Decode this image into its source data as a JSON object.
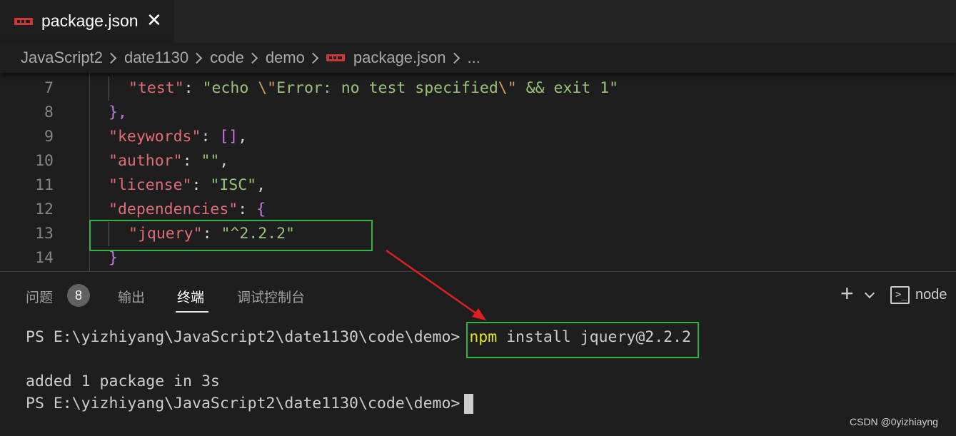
{
  "tab": {
    "icon": "npm-icon",
    "label": "package.json",
    "close": "✕"
  },
  "breadcrumb": {
    "items": [
      "JavaScript2",
      "date1130",
      "code",
      "demo",
      "package.json",
      "..."
    ]
  },
  "editor": {
    "line_numbers": [
      "7",
      "8",
      "9",
      "10",
      "11",
      "12",
      "13",
      "14"
    ],
    "lines": [
      {
        "key": "\"test\"",
        "colon": ": ",
        "value_a": "\"echo ",
        "escape_a": "\\\"",
        "value_b": "Error: no test specified",
        "escape_b": "\\\"",
        "value_c": " && exit 1\""
      },
      {
        "text": "},"
      },
      {
        "key": "\"keywords\"",
        "colon": ": ",
        "value": "[]",
        "tail": ","
      },
      {
        "key": "\"author\"",
        "colon": ": ",
        "value": "\"\"",
        "tail": ","
      },
      {
        "key": "\"license\"",
        "colon": ": ",
        "value": "\"ISC\"",
        "tail": ","
      },
      {
        "key": "\"dependencies\"",
        "colon": ": ",
        "value": "{"
      },
      {
        "key": "\"jquery\"",
        "colon": ": ",
        "value": "\"^2.2.2\""
      },
      {
        "text": "}"
      }
    ]
  },
  "panel": {
    "tabs": [
      {
        "label": "问题",
        "badge": "8"
      },
      {
        "label": "输出"
      },
      {
        "label": "终端",
        "active": true
      },
      {
        "label": "调试控制台"
      }
    ],
    "actions": {
      "add": "+",
      "terminal_name": "node"
    }
  },
  "terminal": {
    "prompt": "PS E:\\yizhiyang\\JavaScript2\\date1130\\code\\demo>",
    "command_npm": "npm",
    "command_rest": " install jquery@2.2.2",
    "output": "added 1 package in 3s",
    "prompt2": "PS E:\\yizhiyang\\JavaScript2\\date1130\\code\\demo>"
  },
  "watermark": "CSDN @0yizhiayng",
  "colors": {
    "highlight_box": "#2fb344",
    "arrow": "#e02020",
    "npm_red": "#cb3837"
  }
}
